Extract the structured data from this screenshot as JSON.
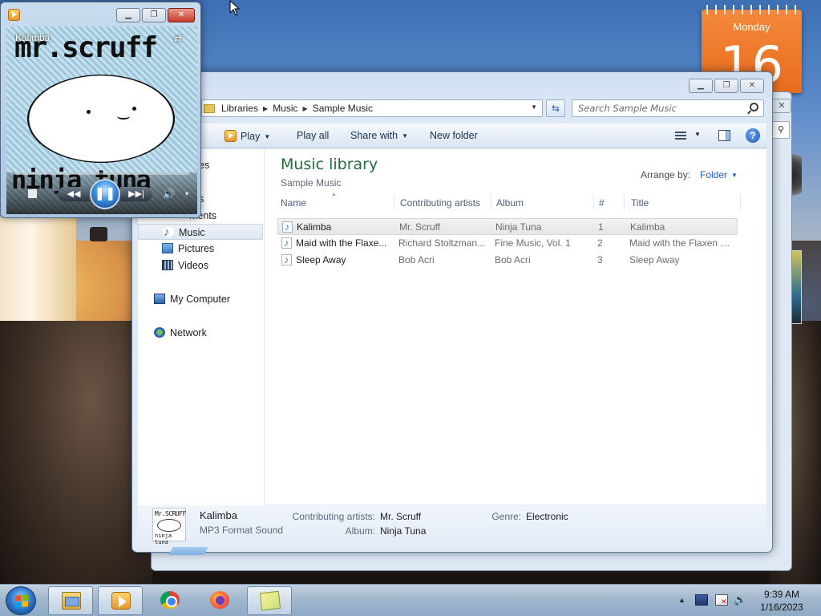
{
  "desktop": {
    "calendar": {
      "day": "Monday",
      "date": "16"
    }
  },
  "media_player": {
    "now_playing": "Kalimba",
    "album_art_top": "mr.scruff",
    "album_art_bottom": "ninja tuna",
    "controls": {
      "pause": "❚❚",
      "prev": "◀◀",
      "next": "▶▶|",
      "volume": "🔊",
      "volume_menu": "▾"
    }
  },
  "explorer": {
    "breadcrumb": [
      "Libraries",
      "Music",
      "Sample Music"
    ],
    "search_placeholder": "Search Sample Music",
    "toolbar": {
      "play": "Play",
      "play_all": "Play all",
      "share_with": "Share with",
      "new_folder": "New folder"
    },
    "nav": {
      "partial_items": [
        "es",
        "s",
        "ments"
      ],
      "music": "Music",
      "pictures": "Pictures",
      "videos": "Videos",
      "my_computer": "My Computer",
      "network": "Network"
    },
    "library": {
      "title": "Music library",
      "subtitle": "Sample Music",
      "arrange_label": "Arrange by:",
      "arrange_value": "Folder"
    },
    "columns": {
      "name": "Name",
      "artists": "Contributing artists",
      "album": "Album",
      "number": "#",
      "title": "Title"
    },
    "rows": [
      {
        "name": "Kalimba",
        "artists": "Mr. Scruff",
        "album": "Ninja Tuna",
        "number": "1",
        "title": "Kalimba"
      },
      {
        "name": "Maid with the Flaxe...",
        "artists": "Richard Stoltzman...",
        "album": "Fine Music, Vol. 1",
        "number": "2",
        "title": "Maid with the Flaxen H..."
      },
      {
        "name": "Sleep Away",
        "artists": "Bob Acri",
        "album": "Bob Acri",
        "number": "3",
        "title": "Sleep Away"
      }
    ],
    "details": {
      "title": "Kalimba",
      "type": "MP3 Format Sound",
      "artists_label": "Contributing artists:",
      "artists_value": "Mr. Scruff",
      "album_label": "Album:",
      "album_value": "Ninja Tuna",
      "genre_label": "Genre:",
      "genre_value": "Electronic",
      "thumb_top": "Mr.SCRUFF",
      "thumb_bottom": "ninja tuna"
    }
  },
  "taskbar": {
    "clock_time": "9:39 AM",
    "clock_date": "1/16/2023"
  }
}
